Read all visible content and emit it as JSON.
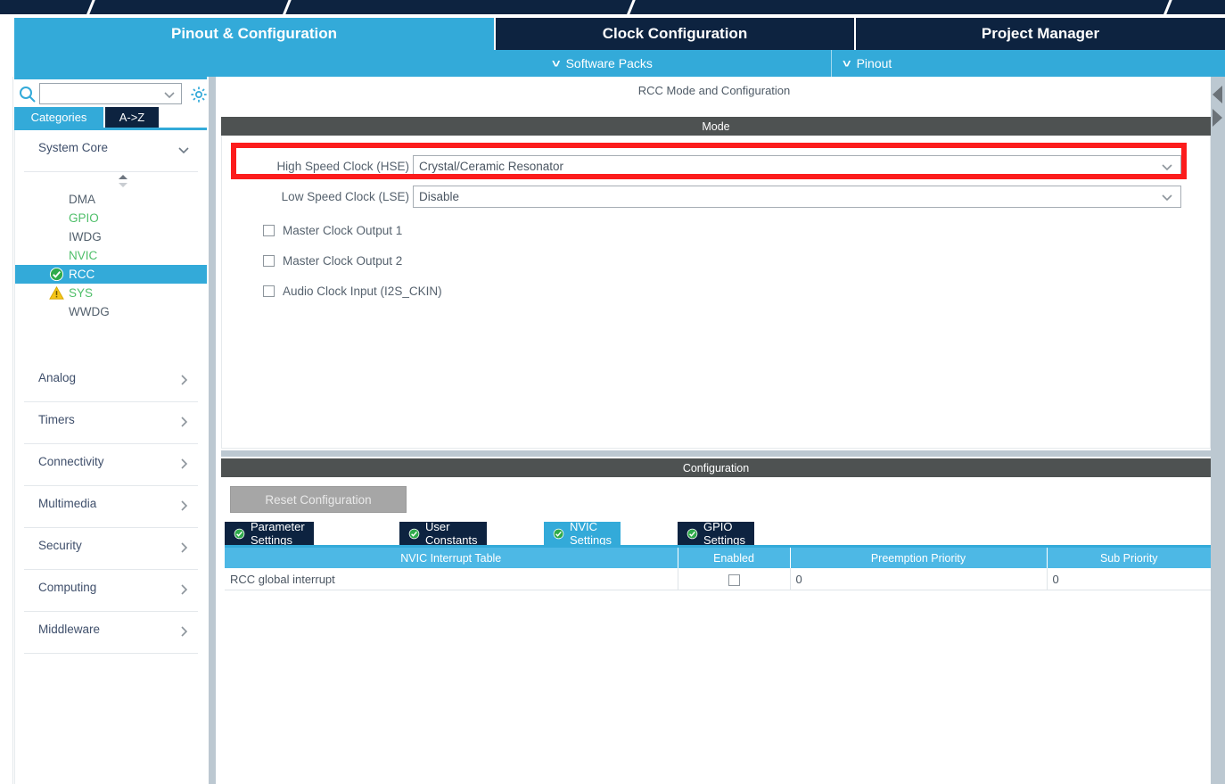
{
  "app": {
    "title": "RCC Mode and Configuration"
  },
  "colors": {
    "accent_blue": "#33aad9",
    "dark_navy": "#0d2340",
    "band_gray": "#4e5252",
    "annotation_red": "#fc1c1c",
    "status_ok_green": "#2eaa4a",
    "status_warn_yellow": "#f5c518",
    "splitter": "#bcc8d1"
  },
  "main_tabs": [
    {
      "label": "Pinout & Configuration",
      "active": true
    },
    {
      "label": "Clock Configuration",
      "active": false
    },
    {
      "label": "Project Manager",
      "active": false
    }
  ],
  "sub_toolbar": {
    "items": [
      {
        "label": "Software Packs",
        "chevron": "chevron-down-icon"
      },
      {
        "label": "Pinout",
        "chevron": "chevron-down-icon"
      }
    ]
  },
  "sidebar": {
    "search": {
      "value": "",
      "placeholder": "",
      "icon": "search-icon",
      "chevron": "chevron-down-icon"
    },
    "gear_icon": "gear-icon",
    "tabs": [
      {
        "label": "Categories",
        "active": true
      },
      {
        "label": "A->Z",
        "active": false
      }
    ],
    "groups": [
      {
        "label": "System Core",
        "expanded": true,
        "chevron": "chevron-down-icon",
        "items": [
          {
            "label": "DMA",
            "state": "none",
            "selected": false
          },
          {
            "label": "GPIO",
            "state": "green",
            "selected": false
          },
          {
            "label": "IWDG",
            "state": "none",
            "selected": false
          },
          {
            "label": "NVIC",
            "state": "green",
            "selected": false
          },
          {
            "label": "RCC",
            "state": "check",
            "selected": true
          },
          {
            "label": "SYS",
            "state": "warning",
            "selected": false
          },
          {
            "label": "WWDG",
            "state": "none",
            "selected": false
          }
        ]
      },
      {
        "label": "Analog",
        "expanded": false,
        "chevron": "chevron-right-icon",
        "items": []
      },
      {
        "label": "Timers",
        "expanded": false,
        "chevron": "chevron-right-icon",
        "items": []
      },
      {
        "label": "Connectivity",
        "expanded": false,
        "chevron": "chevron-right-icon",
        "items": []
      },
      {
        "label": "Multimedia",
        "expanded": false,
        "chevron": "chevron-right-icon",
        "items": []
      },
      {
        "label": "Security",
        "expanded": false,
        "chevron": "chevron-right-icon",
        "items": []
      },
      {
        "label": "Computing",
        "expanded": false,
        "chevron": "chevron-right-icon",
        "items": []
      },
      {
        "label": "Middleware",
        "expanded": false,
        "chevron": "chevron-right-icon",
        "items": []
      }
    ]
  },
  "mode_panel": {
    "band_label": "Mode",
    "rows": [
      {
        "label": "High Speed Clock (HSE)",
        "value": "Crystal/Ceramic Resonator",
        "highlighted": true
      },
      {
        "label": "Low Speed Clock (LSE)",
        "value": "Disable",
        "highlighted": false
      }
    ],
    "checkboxes": [
      {
        "label": "Master Clock Output 1",
        "checked": false
      },
      {
        "label": "Master Clock Output 2",
        "checked": false
      },
      {
        "label": "Audio Clock Input (I2S_CKIN)",
        "checked": false
      }
    ]
  },
  "config_panel": {
    "band_label": "Configuration",
    "reset_button": "Reset Configuration",
    "tabs": [
      {
        "label": "Parameter Settings",
        "active": false,
        "icon": "check-circle-icon"
      },
      {
        "label": "User Constants",
        "active": false,
        "icon": "check-circle-icon"
      },
      {
        "label": "NVIC Settings",
        "active": true,
        "icon": "check-circle-icon"
      },
      {
        "label": "GPIO Settings",
        "active": false,
        "icon": "check-circle-icon"
      }
    ],
    "table": {
      "columns": [
        "NVIC Interrupt Table",
        "Enabled",
        "Preemption Priority",
        "Sub Priority"
      ],
      "rows": [
        {
          "name": "RCC global interrupt",
          "enabled": false,
          "preemption_priority": "0",
          "sub_priority": "0"
        }
      ]
    }
  },
  "right_strip": {
    "arrows": [
      "triangle-left-icon",
      "triangle-right-icon"
    ]
  }
}
